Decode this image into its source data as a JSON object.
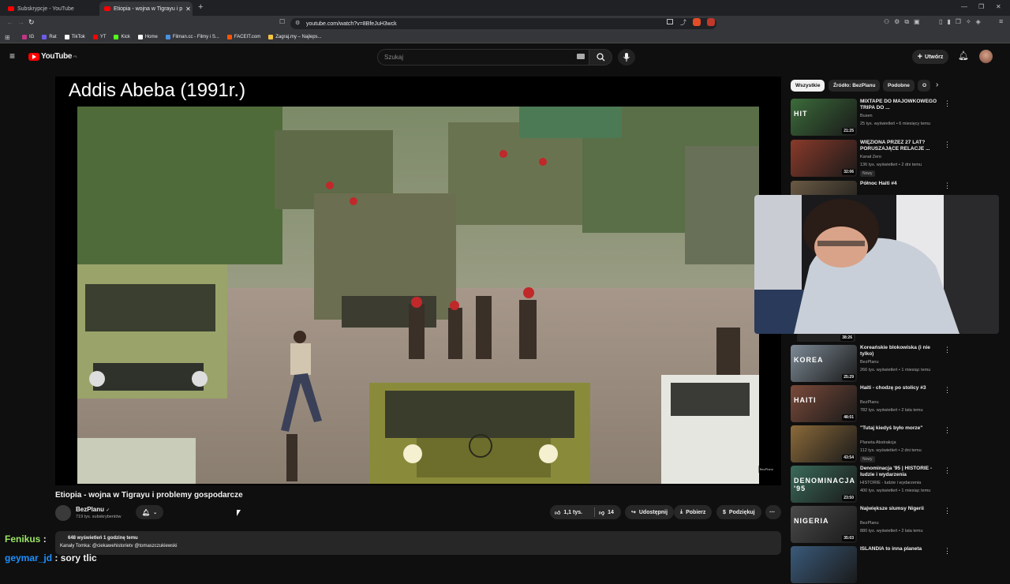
{
  "browser": {
    "tabs": [
      {
        "title": "Subskrypcje - YouTube"
      },
      {
        "title": "Etiopia - wojna w Tigrayu i p"
      }
    ],
    "url": "youtube.com/watch?v=8BfeJuH3wck",
    "bookmarks": [
      "IG",
      "Rat",
      "TikTok",
      "YT",
      "Kick",
      "Home",
      "Filman.cc - Filmy i S...",
      "FACEIT.com",
      "Zagraj.my – Najleps..."
    ],
    "bookmark_colors": [
      "#c13584",
      "#6c5ce7",
      "#ffffff",
      "#ff0000",
      "#53fc18",
      "#ffffff",
      "#4a90e2",
      "#ff5500",
      "#f5c542"
    ]
  },
  "youtube": {
    "logo": "YouTube",
    "logo_region": "PL",
    "search_placeholder": "Szukaj",
    "create_label": "Utwórz"
  },
  "video": {
    "caption": "Addis Abeba (1991r.)",
    "watermark": "BezPlanu",
    "title": "Etiopia - wojna w Tigrayu i problemy gospodarcze",
    "channel": "BezPlanu",
    "subscribers": "719 tys. subskrybentów",
    "likes": "1,1 tys.",
    "dislikes": "14",
    "share": "Udostępnij",
    "download": "Pobierz",
    "thanks": "Podziękuj",
    "views_line": "648 wyświetleń  1 godzinę temu",
    "desc_line": "Kanały Tomka:  @ciekawehistorietv  @tomaszczukiewski"
  },
  "chips": [
    "Wszystkie",
    "Źródło: BezPlanu",
    "Podobne",
    "O"
  ],
  "recommendations": [
    {
      "title": "MIXTAPE DO MAJÓWKOWEGO TRIPA DO ...",
      "channel": "Busen",
      "meta": "25 tys. wyświetleń • 6 miesięcy temu",
      "duration": "21:25",
      "badge": "",
      "thumb_color": "#3b6b3a"
    },
    {
      "title": "WIĘZIONA PRZEZ 27 LAT? PORUSZAJĄCE RELACJE ...",
      "channel": "Kanał Zero",
      "meta": "136 tys. wyświetleń • 2 dni temu",
      "duration": "32:06",
      "badge": "Nowy",
      "thumb_color": "#8a3a2a"
    },
    {
      "title": "Północ Haiti #4",
      "channel": "",
      "meta": "",
      "duration": "",
      "badge": "",
      "thumb_color": "#6a5a44"
    },
    {
      "title": "Koreańskie blokowiska (i nie tylko)",
      "channel": "BezPlanu",
      "meta": "266 tys. wyświetleń • 1 miesiąc temu",
      "duration": "25:29",
      "badge": "",
      "thumb_color": "#7d8a96"
    },
    {
      "title": "Haiti - chodzę po stolicy #3",
      "channel": "BezPlanu",
      "meta": "782 tys. wyświetleń • 2 lata temu",
      "duration": "48:01",
      "badge": "",
      "thumb_color": "#7a4a3a"
    },
    {
      "title": "\"Tutaj kiedyś było morze\"",
      "channel": "Planeta Abstrakcja",
      "meta": "112 tys. wyświetleń • 2 dni temu",
      "duration": "43:54",
      "badge": "Nowy",
      "thumb_color": "#8b6a3a"
    },
    {
      "title": "Denominacja '95 | HISTORIE - ludzie i wydarzenia",
      "channel": "HISTORIE - ludzie i wydarzenia",
      "meta": "400 tys. wyświetleń • 1 miesiąc temu",
      "duration": "23:50",
      "badge": "",
      "thumb_color": "#3a6a5a"
    },
    {
      "title": "Największe slumsy Nigerii",
      "channel": "BezPlanu",
      "meta": "880 tys. wyświetleń • 2 lata temu",
      "duration": "35:03",
      "badge": "",
      "thumb_color": "#4a4a4a"
    },
    {
      "title": "ISLANDIA to inna planeta",
      "channel": "",
      "meta": "",
      "duration": "",
      "badge": "",
      "thumb_color": "#3a5a7a"
    }
  ],
  "thumb_texts": [
    "HIT",
    "",
    "",
    "KOREA",
    "HAITI",
    "",
    "DENOMINACJA '95",
    "NIGERIA",
    ""
  ],
  "hidden_duration": "38:26",
  "chat": [
    {
      "user": "Fenikus",
      "color": "#9be564",
      "text": ""
    },
    {
      "user": "geymar_jd",
      "color": "#1e90ff",
      "text": "sory tlic"
    }
  ]
}
